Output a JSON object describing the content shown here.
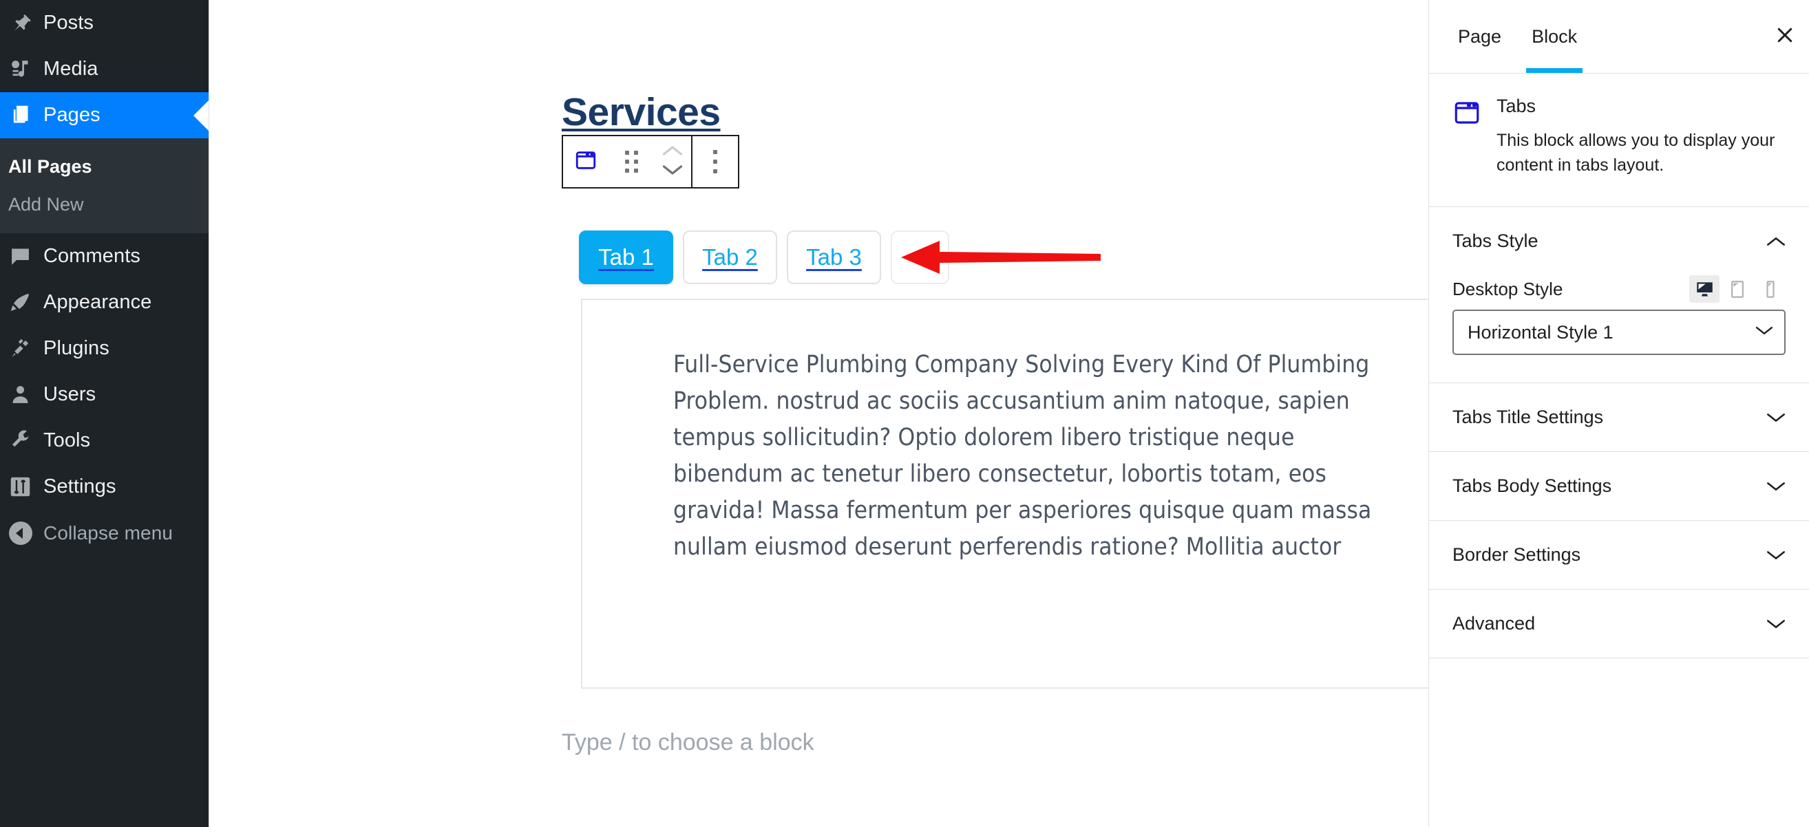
{
  "sidebar": {
    "items": [
      {
        "label": "Posts",
        "icon": "pin-icon",
        "current": false
      },
      {
        "label": "Media",
        "icon": "media-icon",
        "current": false
      },
      {
        "label": "Pages",
        "icon": "pages-icon",
        "current": true
      },
      {
        "label": "Comments",
        "icon": "comment-icon",
        "current": false
      },
      {
        "label": "Appearance",
        "icon": "paintbrush-icon",
        "current": false
      },
      {
        "label": "Plugins",
        "icon": "plugin-icon",
        "current": false
      },
      {
        "label": "Users",
        "icon": "user-icon",
        "current": false
      },
      {
        "label": "Tools",
        "icon": "wrench-icon",
        "current": false
      },
      {
        "label": "Settings",
        "icon": "settings-sliders-icon",
        "current": false
      }
    ],
    "submenu": [
      {
        "label": "All Pages",
        "current": true
      },
      {
        "label": "Add New",
        "current": false
      }
    ],
    "collapse_label": "Collapse menu",
    "active_color": "#0080ff",
    "background_color": "#1d2327",
    "submenu_background_color": "#2c3338"
  },
  "editor": {
    "post_title": "Services",
    "toolbar": {
      "block_icon": "tabs-block-icon",
      "drag_handle": "drag-handle-icon",
      "move_up": "chevron-up-icon",
      "move_down": "chevron-down-icon",
      "more_options": "ellipsis-vertical-icon"
    },
    "tabs": [
      {
        "label": "Tab 1",
        "active": true
      },
      {
        "label": "Tab 2",
        "active": false
      },
      {
        "label": "Tab 3",
        "active": false
      }
    ],
    "add_tab_label": "+",
    "active_tab_color": "#07a9f0",
    "tab_link_color": "#11a8f0",
    "tab_body_text": "Full-Service Plumbing Company Solving Every Kind Of Plumbing Problem. nostrud ac sociis accusantium anim natoque, sapien tempus sollicitudin? Optio dolorem libero tristique neque bibendum ac tenetur libero consectetur, lobortis totam, eos gravida! Massa fermentum per asperiores quisque quam massa nullam eiusmod deserunt perferendis ratione? Mollitia auctor",
    "appender_placeholder": "Type / to choose a block",
    "annotation": {
      "type": "red-arrow",
      "color": "#ee1111",
      "points_to": "add-tab-button"
    }
  },
  "inspector": {
    "tabs": [
      {
        "label": "Page",
        "active": false
      },
      {
        "label": "Block",
        "active": true
      }
    ],
    "close_label": "close-icon",
    "active_tab_underline_color": "#06aaf0",
    "block_card": {
      "icon": "tabs-block-icon",
      "title": "Tabs",
      "description": "This block allows you to display your content in tabs layout."
    },
    "sections": [
      {
        "title": "Tabs Style",
        "expanded": true,
        "field_label": "Desktop Style",
        "devices": [
          {
            "name": "desktop-icon",
            "active": true
          },
          {
            "name": "tablet-icon",
            "active": false
          },
          {
            "name": "mobile-icon",
            "active": false
          }
        ],
        "select_value": "Horizontal Style 1"
      },
      {
        "title": "Tabs Title Settings",
        "expanded": false
      },
      {
        "title": "Tabs Body Settings",
        "expanded": false
      },
      {
        "title": "Border Settings",
        "expanded": false
      },
      {
        "title": "Advanced",
        "expanded": false
      }
    ]
  }
}
